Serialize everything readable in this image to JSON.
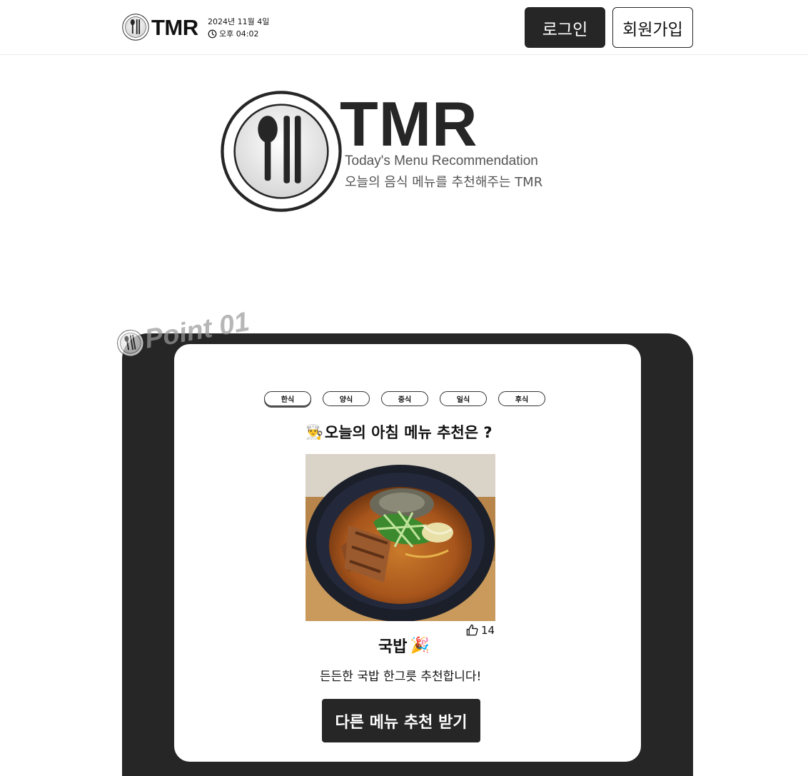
{
  "header": {
    "logo_text": "TMR",
    "date": "2024년 11월 4일",
    "time": "오후 04:02",
    "login_label": "로그인",
    "signup_label": "회원가입"
  },
  "hero": {
    "title": "TMR",
    "subtitle_en": "Today's Menu Recommendation",
    "subtitle_ko": "오늘의 음식 메뉴를 추천해주는 TMR"
  },
  "section": {
    "point_label": "Point 01",
    "tabs": [
      {
        "label": "한식",
        "active": true
      },
      {
        "label": "양식",
        "active": false
      },
      {
        "label": "중식",
        "active": false
      },
      {
        "label": "일식",
        "active": false
      },
      {
        "label": "후식",
        "active": false
      }
    ],
    "question": "오늘의 아침 메뉴 추천은 ?",
    "question_icon": "chef-icon",
    "dish": {
      "name": "국밥",
      "name_icon": "party-popper-icon",
      "likes": "14",
      "description": "든든한 국밥 한그릇 추천합니다!"
    },
    "recommend_button": "다른 메뉴 추천 받기"
  },
  "colors": {
    "dark": "#262626",
    "subtext": "#555555",
    "background": "#ffffff"
  }
}
